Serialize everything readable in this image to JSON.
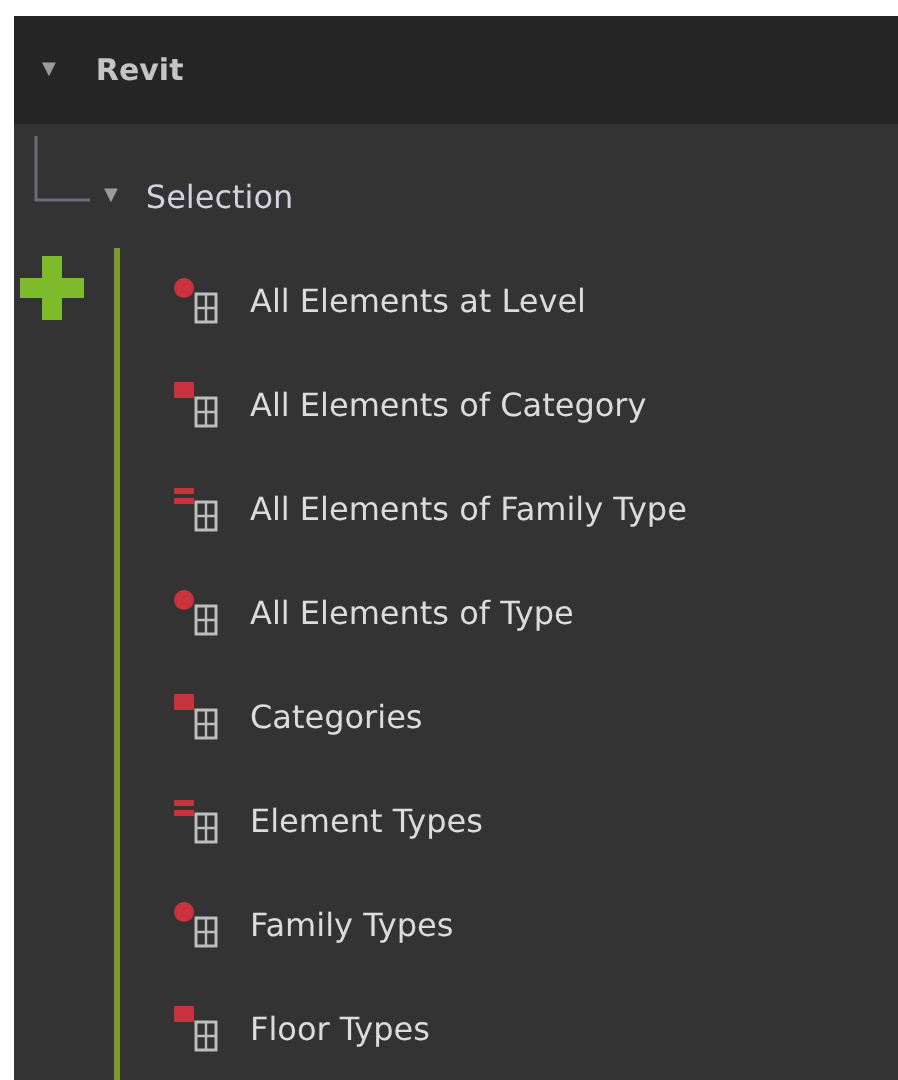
{
  "header": {
    "arrow": "▼",
    "title": "Revit",
    "expanded": true
  },
  "group": {
    "arrow": "▼",
    "title": "Selection",
    "expanded": true,
    "items": [
      {
        "label": "All Elements at Level"
      },
      {
        "label": "All Elements of Category"
      },
      {
        "label": "All Elements of Family Type"
      },
      {
        "label": "All Elements of Type"
      },
      {
        "label": "Categories"
      },
      {
        "label": "Element Types"
      },
      {
        "label": "Family Types"
      },
      {
        "label": "Floor Types"
      }
    ]
  }
}
